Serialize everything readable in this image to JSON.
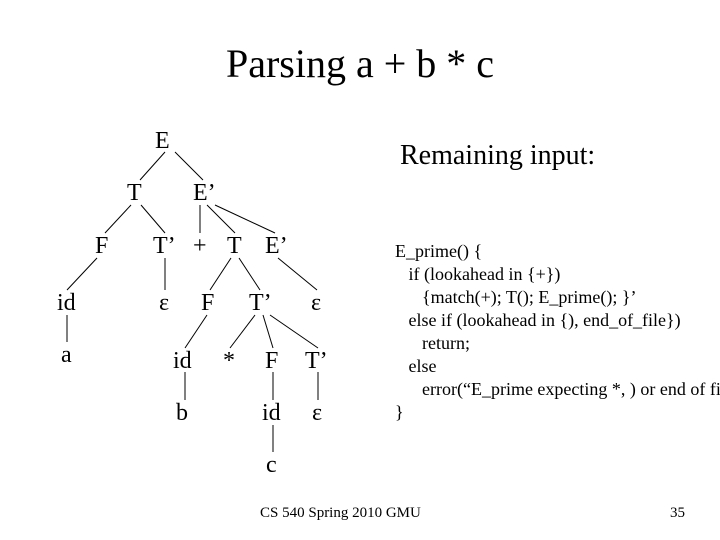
{
  "title": "Parsing a + b * c",
  "remaining_label": "Remaining input:",
  "tree": {
    "n0": "E",
    "n1": "T",
    "n2": "E’",
    "n3": "F",
    "n4": "T’",
    "n5": "+",
    "n6": "T",
    "n7": "E’",
    "n8": "id",
    "n9": "a",
    "n10": "ε",
    "n11": "F",
    "n12": "T’",
    "n13": "ε",
    "n14": "id",
    "n15": "b",
    "n16": "*",
    "n17": "F",
    "n18": "T’",
    "n19": "id",
    "n20": "c",
    "n21": "ε"
  },
  "code": {
    "l0": "E_prime() {",
    "l1": "   if (lookahead in {+})",
    "l2": "      {match(+); T(); E_prime(); }’",
    "l3": "   else if (lookahead in {), end_of_file})",
    "l4": "      return;",
    "l5": "   else",
    "l6": "      error(“E_prime expecting *, ) or end of file”); }",
    "l7": "}"
  },
  "footer": {
    "left": "CS 540 Spring 2010 GMU",
    "right": "35"
  }
}
